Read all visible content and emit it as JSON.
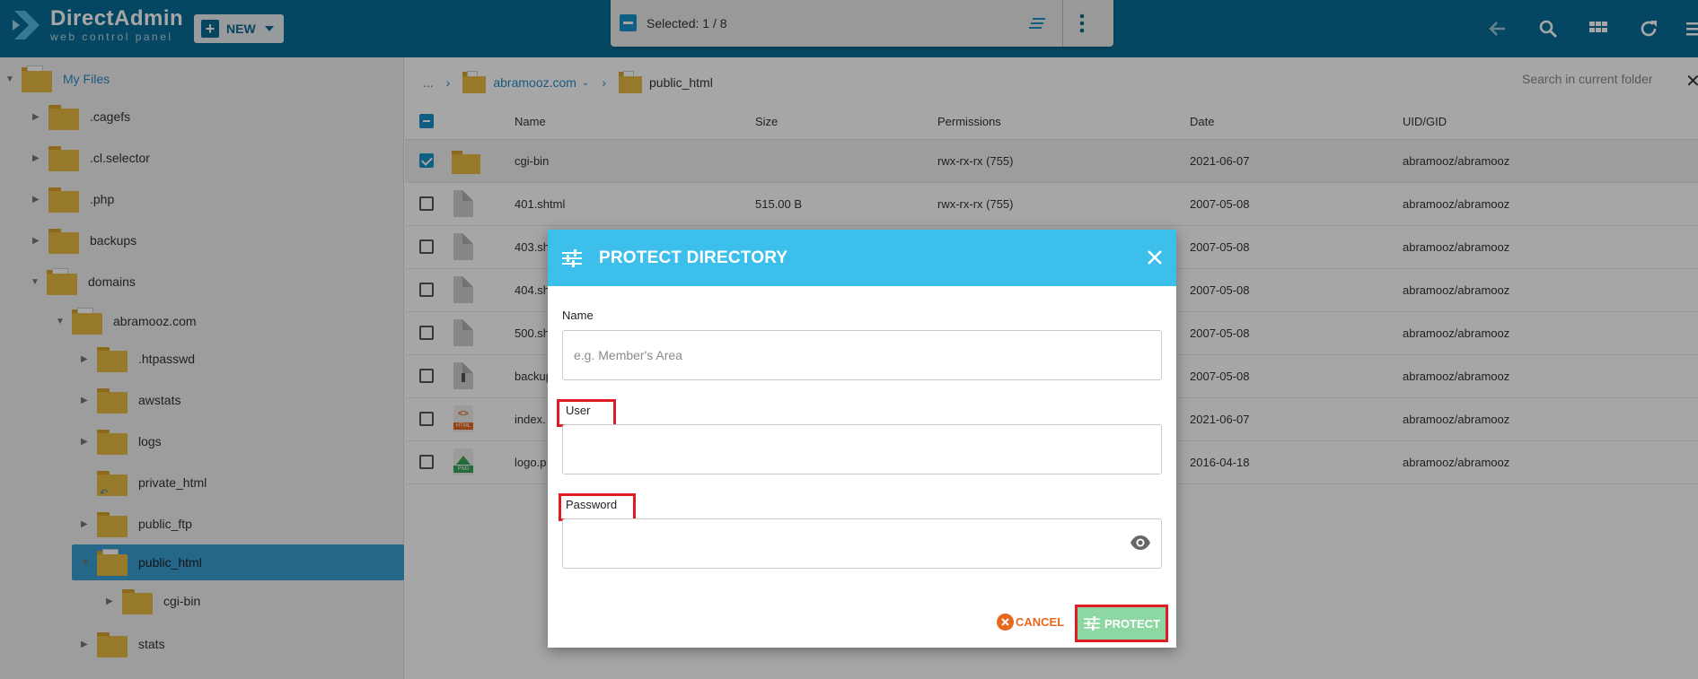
{
  "header": {
    "logo_title": "DirectAdmin",
    "logo_subtitle": "web control panel",
    "new_label": "NEW",
    "selection_label": "Selected: 1 / 8"
  },
  "sidebar": {
    "root": "My Files",
    "items": [
      {
        "label": ".cagefs"
      },
      {
        "label": ".cl.selector"
      },
      {
        "label": ".php"
      },
      {
        "label": "backups"
      },
      {
        "label": "domains"
      },
      {
        "label": "abramooz.com"
      },
      {
        "label": ".htpasswd"
      },
      {
        "label": "awstats"
      },
      {
        "label": "logs"
      },
      {
        "label": "private_html"
      },
      {
        "label": "public_ftp"
      },
      {
        "label": "public_html"
      },
      {
        "label": "cgi-bin"
      },
      {
        "label": "stats"
      }
    ]
  },
  "breadcrumb": {
    "ellipsis": "...",
    "domain": "abramooz.com",
    "current": "public_html"
  },
  "search": {
    "placeholder": "Search in current folder"
  },
  "table": {
    "columns": [
      "Name",
      "Size",
      "Permissions",
      "Date",
      "UID/GID"
    ],
    "rows": [
      {
        "name": "cgi-bin",
        "size": "",
        "perm": "rwx-rx-rx (755)",
        "date": "2021-06-07",
        "uid": "abramooz/abramooz"
      },
      {
        "name": "401.shtml",
        "size": "515.00 B",
        "perm": "rwx-rx-rx (755)",
        "date": "2007-05-08",
        "uid": "abramooz/abramooz"
      },
      {
        "name": "403.sh",
        "size": "",
        "perm": "",
        "date": "2007-05-08",
        "uid": "abramooz/abramooz"
      },
      {
        "name": "404.sh",
        "size": "",
        "perm": "",
        "date": "2007-05-08",
        "uid": "abramooz/abramooz"
      },
      {
        "name": "500.sh",
        "size": "",
        "perm": "",
        "date": "2007-05-08",
        "uid": "abramooz/abramooz"
      },
      {
        "name": "backup",
        "size": "",
        "perm": "",
        "date": "2007-05-08",
        "uid": "abramooz/abramooz"
      },
      {
        "name": "index.",
        "size": "",
        "perm": "",
        "date": "2021-06-07",
        "uid": "abramooz/abramooz"
      },
      {
        "name": "logo.p",
        "size": "",
        "perm": "",
        "date": "2016-04-18",
        "uid": "abramooz/abramooz"
      }
    ]
  },
  "modal": {
    "title": "PROTECT DIRECTORY",
    "name_label": "Name",
    "name_placeholder": "e.g. Member's Area",
    "user_label": "User",
    "password_label": "Password",
    "cancel_label": "CANCEL",
    "protect_label": "PROTECT"
  },
  "file_badges": {
    "html": "HTML",
    "png": "PNG"
  },
  "colors": {
    "header": "#086e97",
    "modal_header": "#3dbfeb",
    "protect_button": "#8dd8a2",
    "cancel": "#e8691d",
    "highlight": "#e01c24",
    "folder": "#e8bb44"
  }
}
